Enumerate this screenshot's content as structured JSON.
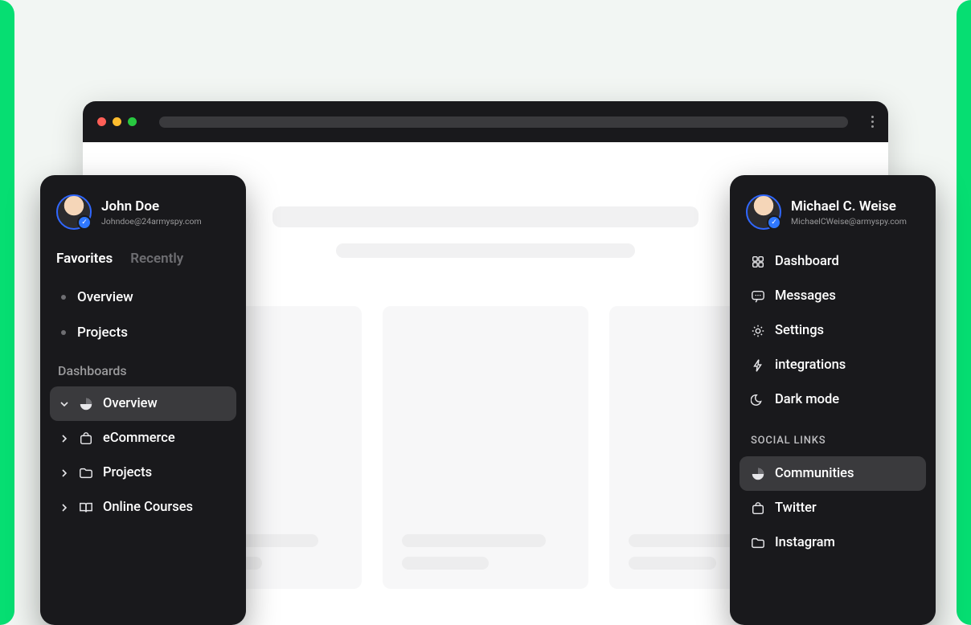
{
  "left_panel": {
    "user": {
      "name": "John Doe",
      "email": "Johndoe@24armyspy.com"
    },
    "tabs": {
      "favorites": "Favorites",
      "recently": "Recently"
    },
    "quick": {
      "overview": "Overview",
      "projects": "Projects"
    },
    "section": "Dashboards",
    "items": {
      "overview": "Overview",
      "ecommerce": "eCommerce",
      "projects": "Projects",
      "courses": "Online Courses"
    }
  },
  "right_panel": {
    "user": {
      "name": "Michael C. Weise",
      "email": "MichaelCWeise@armyspy.com"
    },
    "menu": {
      "dashboard": "Dashboard",
      "messages": "Messages",
      "settings": "Settings",
      "integrations": "integrations",
      "darkmode": "Dark mode"
    },
    "section": "SOCIAL LINKS",
    "social": {
      "communities": "Communities",
      "twitter": "Twitter",
      "instagram": "Instagram"
    }
  }
}
